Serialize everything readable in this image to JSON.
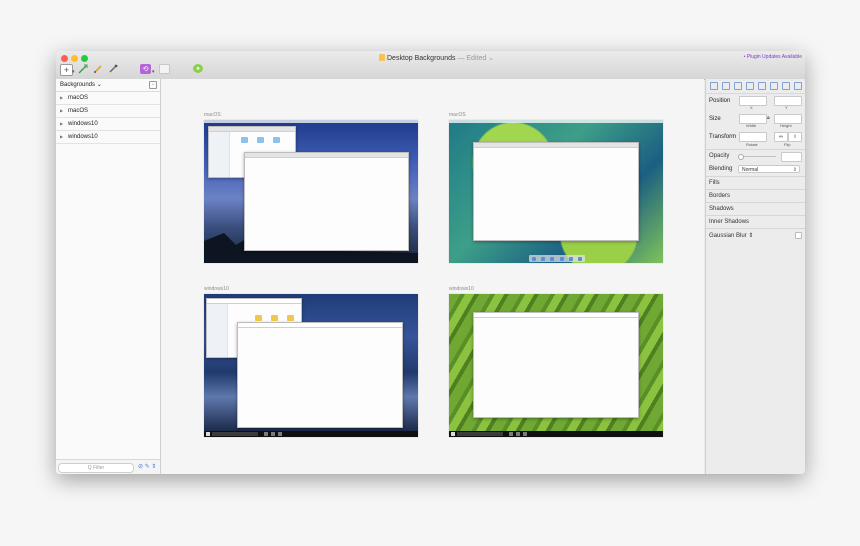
{
  "window": {
    "title": "Desktop Backgrounds",
    "edited": "— Edited ⌄",
    "plugin_badge": "• Plugin Updates Available"
  },
  "toolbar": {
    "insert_icon": "plus-icon",
    "symbol_icon": "symbol-icon",
    "plugin_icon": "plugin-icon"
  },
  "sidebar": {
    "header": "Backgrounds ⌄",
    "items": [
      {
        "label": "macOS"
      },
      {
        "label": "macOS"
      },
      {
        "label": "windows10"
      },
      {
        "label": "windows10"
      }
    ],
    "filter_placeholder": "Q  Filter"
  },
  "canvas": {
    "artboards": [
      {
        "label": "macOS",
        "kind": "mac-night"
      },
      {
        "label": "macOS",
        "kind": "mac-green"
      },
      {
        "label": "windows10",
        "kind": "win-storm"
      },
      {
        "label": "windows10",
        "kind": "win-fields"
      }
    ]
  },
  "inspector": {
    "position_label": "Position",
    "x_label": "X",
    "y_label": "Y",
    "size_label": "Size",
    "width_label": "Width",
    "height_label": "Height",
    "transform_label": "Transform",
    "rotate_label": "Rotate",
    "flip_label": "Flip",
    "opacity_label": "Opacity",
    "blending_label": "Blending",
    "blending_value": "Normal",
    "sections": [
      "Fills",
      "Borders",
      "Shadows",
      "Inner Shadows",
      "Gaussian Blur ⇕"
    ]
  }
}
